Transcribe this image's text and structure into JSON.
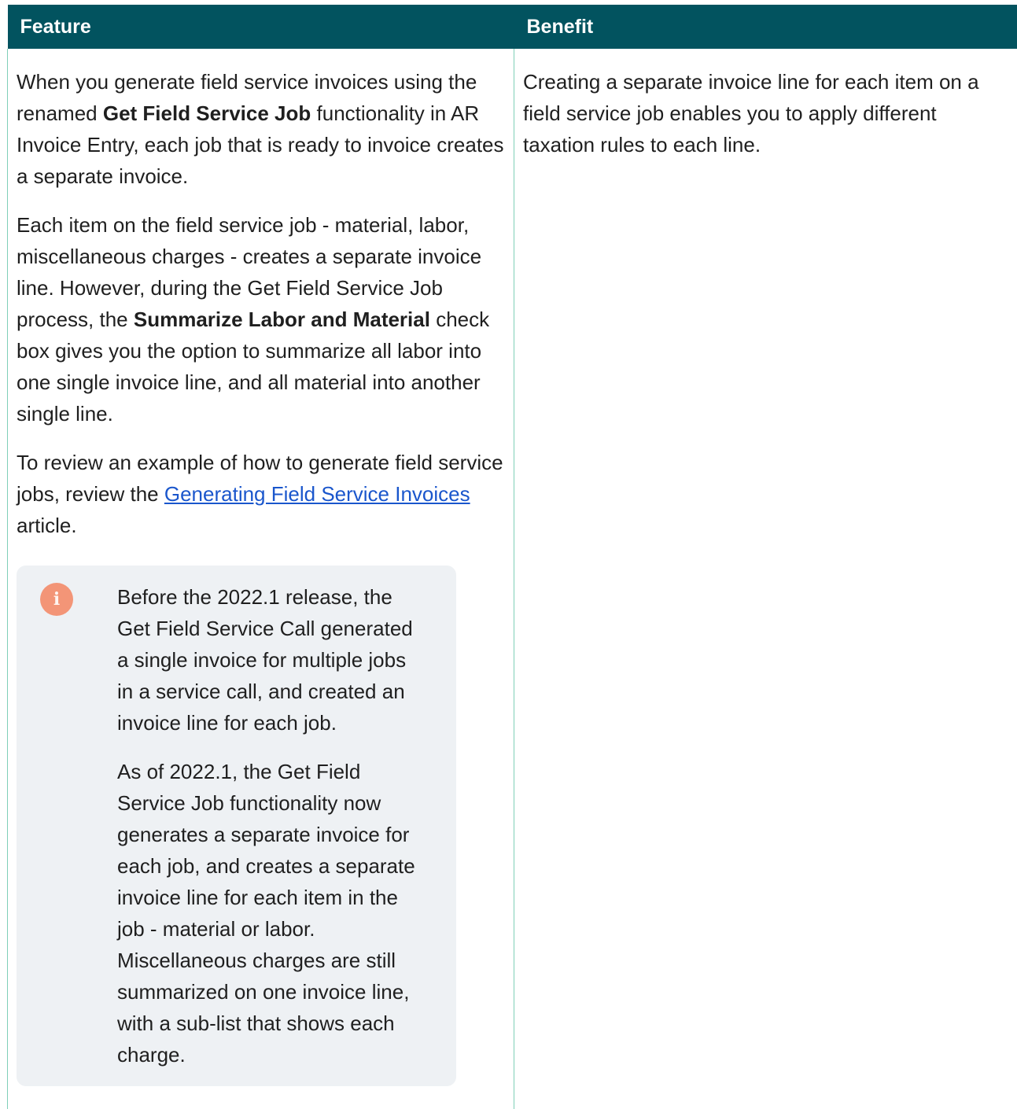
{
  "table": {
    "header_feature": "Feature",
    "header_benefit": "Benefit"
  },
  "feature": {
    "para1": [
      {
        "text": "When you generate field service invoices using the renamed ",
        "bold": false
      },
      {
        "text": "Get Field Service Job",
        "bold": true
      },
      {
        "text": " functionality in AR Invoice Entry, each job that is ready to invoice creates a separate invoice.",
        "bold": false
      }
    ],
    "para2": [
      {
        "text": "Each item on the field service job - material, labor, miscellaneous charges - creates a separate invoice line. However, during the Get Field Service Job process, the ",
        "bold": false
      },
      {
        "text": "Summarize Labor and Material",
        "bold": true
      },
      {
        "text": " check box gives you the option to summarize all labor into one single invoice line, and all material into another single line.",
        "bold": false
      }
    ],
    "para3": {
      "before": "To review an example of how to generate field service jobs, review the ",
      "link": "Generating Field Service Invoices",
      "after": " article."
    },
    "note": {
      "icon": "info-icon",
      "icon_glyph": "i",
      "icon_color": "#f39577",
      "para1": "Before the 2022.1 release, the Get Field Service Call generated a single invoice for multiple jobs in a service call, and created an invoice line for each job.",
      "para2": "As of 2022.1, the Get Field Service Job functionality now generates a separate invoice for each job, and creates a separate invoice line for each item in the job - material or labor. Miscellaneous charges are still summarized on one invoice line, with a sub-list that shows each charge."
    }
  },
  "benefit": {
    "para1": "Creating a separate invoice line for each item on a field service job enables you to apply different taxation rules to each line."
  },
  "colors": {
    "header_bg": "#02535f",
    "border": "#7fcfb8",
    "link": "#1a56cc",
    "note_bg": "#eef1f4"
  }
}
